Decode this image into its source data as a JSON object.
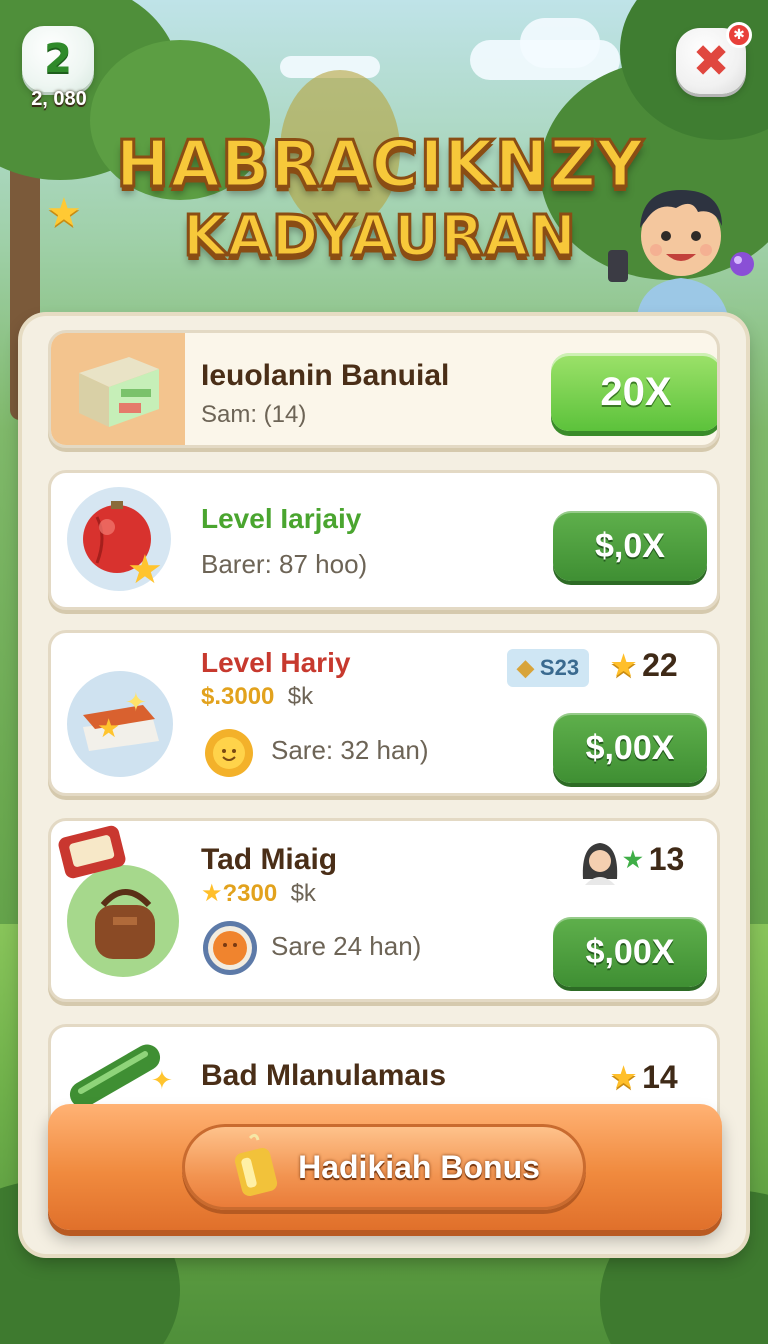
{
  "header": {
    "level": "2",
    "coins": "2, 080",
    "close_symbol": "✖",
    "title_line1": "HABRACIKNZY",
    "title_line2": "KADYAURAN"
  },
  "items": [
    {
      "title": "Ieuolanin Banuial",
      "subtitle": "Sam: (14)",
      "button": "20X",
      "icon": "package-box-icon"
    },
    {
      "title": "Level Iarjaiy",
      "subtitle": "Barer: 87 hoo)",
      "button": "$,0X",
      "icon": "red-ball-star-icon"
    },
    {
      "title": "Level Hariy",
      "price": "$.3000",
      "price_suffix": "$k",
      "chip": "S23",
      "stat": "22",
      "subtitle": "Sare: 32 han)",
      "button": "$,00X",
      "icon": "treasure-box-icon"
    },
    {
      "title": "Tad Miaig",
      "price": "?300",
      "price_suffix": "$k",
      "stat": "13",
      "subtitle": "Sare 24 han)",
      "button": "$,00X",
      "icon": "leather-bag-icon"
    },
    {
      "title": "Bad Mlanulamaıs",
      "stat": "14",
      "icon": "green-tube-icon"
    }
  ],
  "bonus": {
    "label": "Hadikiah Bonus",
    "icon": "golden-cup-icon"
  },
  "colors": {
    "panel": "#f4efe2",
    "button_green": "#3f8f33",
    "button_bright": "#5cc23b",
    "bonus_orange": "#f08a3e",
    "title_gold": "#f7c83a",
    "star": "#ffbf2a"
  }
}
